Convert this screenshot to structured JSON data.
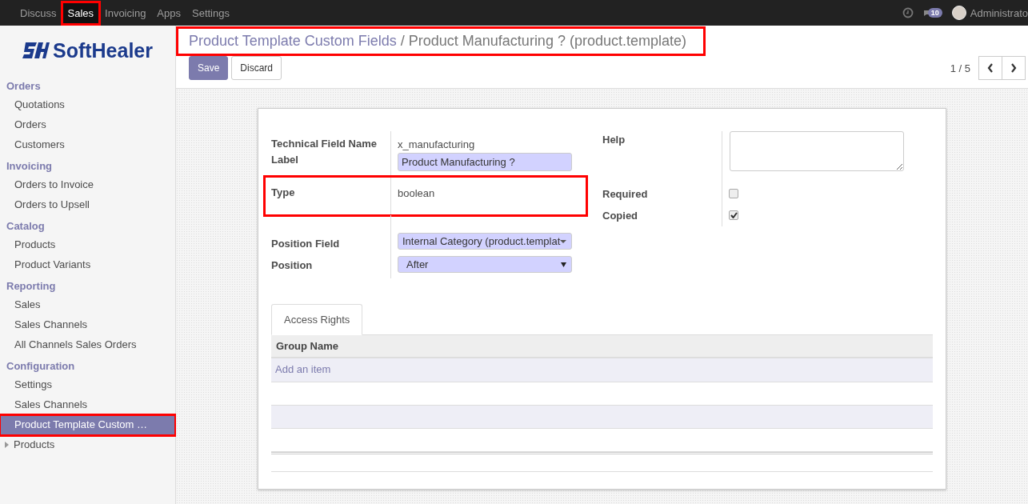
{
  "top_menu": [
    {
      "label": "Discuss",
      "selected": false,
      "highlighted": false
    },
    {
      "label": "Sales",
      "selected": true,
      "highlighted": true
    },
    {
      "label": "Invoicing",
      "selected": false,
      "highlighted": false
    },
    {
      "label": "Apps",
      "selected": false,
      "highlighted": false
    },
    {
      "label": "Settings",
      "selected": false,
      "highlighted": false
    }
  ],
  "systray": {
    "message_count": "10",
    "user": "Administrato"
  },
  "logo": {
    "text": "SoftHealer"
  },
  "sidebar": [
    {
      "heading": "Orders",
      "items": [
        {
          "label": "Quotations",
          "selected": false,
          "highlighted": false
        },
        {
          "label": "Orders",
          "selected": false,
          "highlighted": false
        },
        {
          "label": "Customers",
          "selected": false,
          "highlighted": false
        }
      ]
    },
    {
      "heading": "Invoicing",
      "items": [
        {
          "label": "Orders to Invoice",
          "selected": false,
          "highlighted": false
        },
        {
          "label": "Orders to Upsell",
          "selected": false,
          "highlighted": false
        }
      ]
    },
    {
      "heading": "Catalog",
      "items": [
        {
          "label": "Products",
          "selected": false,
          "highlighted": false
        },
        {
          "label": "Product Variants",
          "selected": false,
          "highlighted": false
        }
      ]
    },
    {
      "heading": "Reporting",
      "items": [
        {
          "label": "Sales",
          "selected": false,
          "highlighted": false
        },
        {
          "label": "Sales Channels",
          "selected": false,
          "highlighted": false
        },
        {
          "label": "All Channels Sales Orders",
          "selected": false,
          "highlighted": false
        }
      ]
    },
    {
      "heading": "Configuration",
      "items": [
        {
          "label": "Settings",
          "selected": false,
          "highlighted": false
        },
        {
          "label": "Sales Channels",
          "selected": false,
          "highlighted": false
        },
        {
          "label": "Product Template Custom …",
          "selected": true,
          "highlighted": true
        }
      ]
    }
  ],
  "sidebar_tree": [
    {
      "label": "Products",
      "expanded": false
    }
  ],
  "breadcrumb": {
    "parent": "Product Template Custom Fields",
    "separator": "/",
    "current": "Product Manufacturing ? (product.template)",
    "highlighted": true
  },
  "buttons": [
    {
      "label": "Save",
      "kind": "primary"
    },
    {
      "label": "Discard",
      "kind": "secondary"
    }
  ],
  "pager": {
    "text": "1 / 5"
  },
  "form_left": [
    {
      "label": "Technical Field Name",
      "kind": "text",
      "value": "x_manufacturing",
      "highlighted": false
    },
    {
      "label": "Label",
      "kind": "input",
      "value": "Product Manufacturing ?",
      "highlighted": false
    },
    {
      "label": "Type",
      "kind": "text",
      "value": "boolean",
      "highlighted": true
    },
    {
      "label": "Position Field",
      "kind": "many2one",
      "value": "Internal Category (product.templat",
      "highlighted": false
    },
    {
      "label": "Position",
      "kind": "select",
      "value": "After",
      "highlighted": false
    }
  ],
  "form_right": [
    {
      "label": "Help",
      "kind": "textarea"
    },
    {
      "label": "Required",
      "kind": "checkbox",
      "checked": false
    },
    {
      "label": "Copied",
      "kind": "checkbox",
      "checked": true
    }
  ],
  "tabs": [
    {
      "label": "Access Rights",
      "selected": true
    }
  ],
  "table": {
    "columns": [
      "Group Name"
    ],
    "add_item": "Add an item"
  }
}
